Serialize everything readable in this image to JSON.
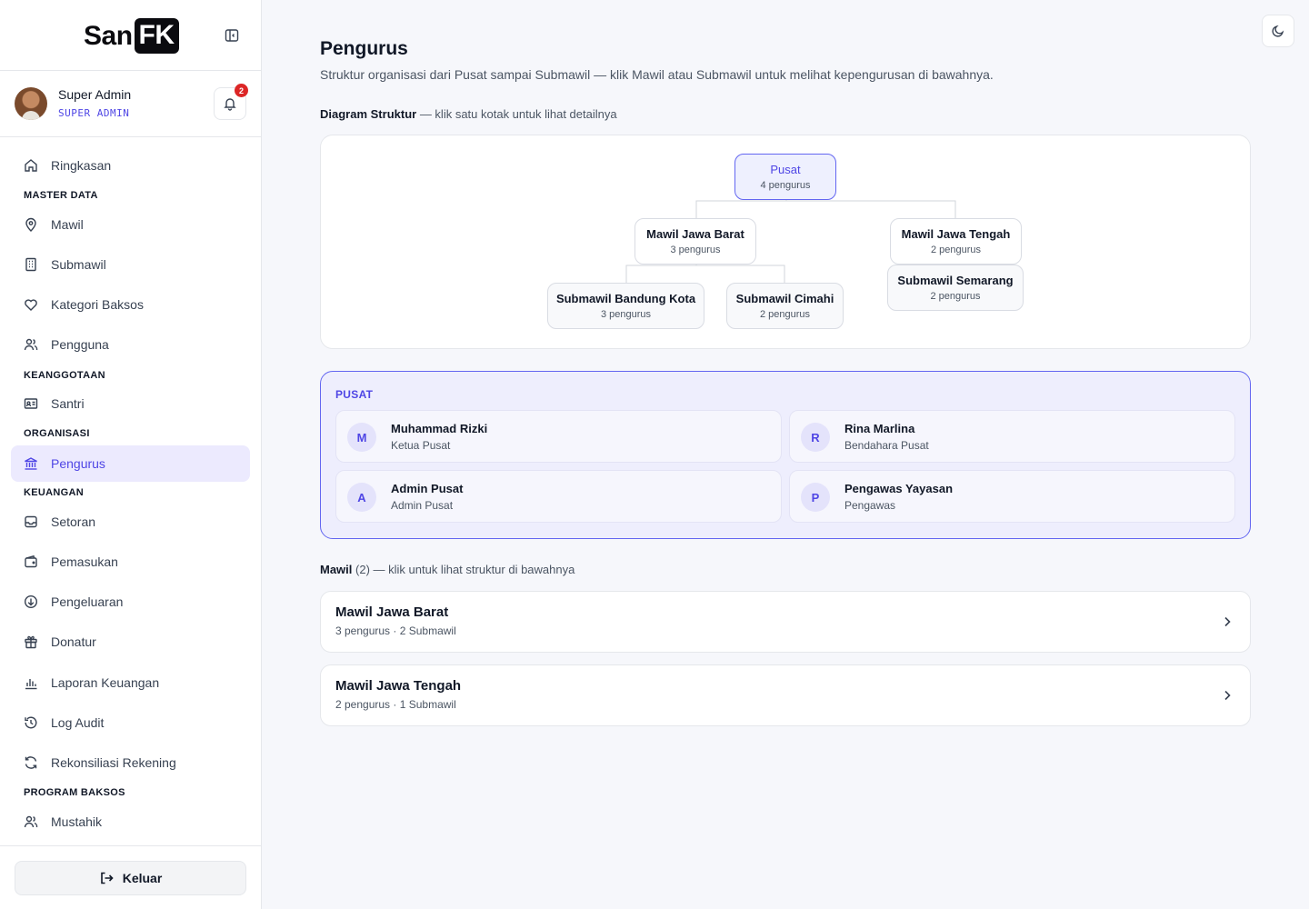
{
  "brand": {
    "logo_text": "San",
    "logo_box": "FK"
  },
  "user": {
    "name": "Super Admin",
    "role": "SUPER ADMIN",
    "notification_count": "2"
  },
  "nav": {
    "ringkasan": "Ringkasan",
    "section_master": "MASTER DATA",
    "mawil": "Mawil",
    "submawil": "Submawil",
    "kategori": "Kategori Baksos",
    "pengguna": "Pengguna",
    "section_keanggotaan": "KEANGGOTAAN",
    "santri": "Santri",
    "section_organisasi": "ORGANISASI",
    "pengurus": "Pengurus",
    "section_keuangan": "KEUANGAN",
    "setoran": "Setoran",
    "pemasukan": "Pemasukan",
    "pengeluaran": "Pengeluaran",
    "donatur": "Donatur",
    "laporan": "Laporan Keuangan",
    "log": "Log Audit",
    "rekonsiliasi": "Rekonsiliasi Rekening",
    "section_baksos": "PROGRAM BAKSOS",
    "mustahik": "Mustahik",
    "logout": "Keluar"
  },
  "page": {
    "title": "Pengurus",
    "description": "Struktur organisasi dari Pusat sampai Submawil — klik Mawil atau Submawil untuk melihat kepengurusan di bawahnya."
  },
  "diagram": {
    "label_bold": "Diagram Struktur",
    "label_rest": " — klik satu kotak untuk lihat detailnya",
    "root": {
      "title": "Pusat",
      "sub": "4 pengurus"
    },
    "mawil_jabar": {
      "title": "Mawil Jawa Barat",
      "sub": "3 pengurus"
    },
    "mawil_jateng": {
      "title": "Mawil Jawa Tengah",
      "sub": "2 pengurus"
    },
    "sub_bandung": {
      "title": "Submawil Bandung Kota",
      "sub": "3 pengurus"
    },
    "sub_cimahi": {
      "title": "Submawil Cimahi",
      "sub": "2 pengurus"
    },
    "sub_semarang": {
      "title": "Submawil Semarang",
      "sub": "2 pengurus"
    }
  },
  "pusat": {
    "label": "PUSAT",
    "members": [
      {
        "initial": "M",
        "name": "Muhammad Rizki",
        "role": "Ketua Pusat"
      },
      {
        "initial": "R",
        "name": "Rina Marlina",
        "role": "Bendahara Pusat"
      },
      {
        "initial": "A",
        "name": "Admin Pusat",
        "role": "Admin Pusat"
      },
      {
        "initial": "P",
        "name": "Pengawas Yayasan",
        "role": "Pengawas"
      }
    ]
  },
  "mawil_list": {
    "label_bold": "Mawil",
    "label_count": " (2)",
    "label_rest": " — klik untuk lihat struktur di bawahnya",
    "items": [
      {
        "title": "Mawil Jawa Barat",
        "sub": "3 pengurus · 2 Submawil"
      },
      {
        "title": "Mawil Jawa Tengah",
        "sub": "2 pengurus · 1 Submawil"
      }
    ]
  },
  "colors": {
    "accent": "#4f46e5",
    "accent_bg": "#eeeefd",
    "badge": "#dc2626"
  }
}
